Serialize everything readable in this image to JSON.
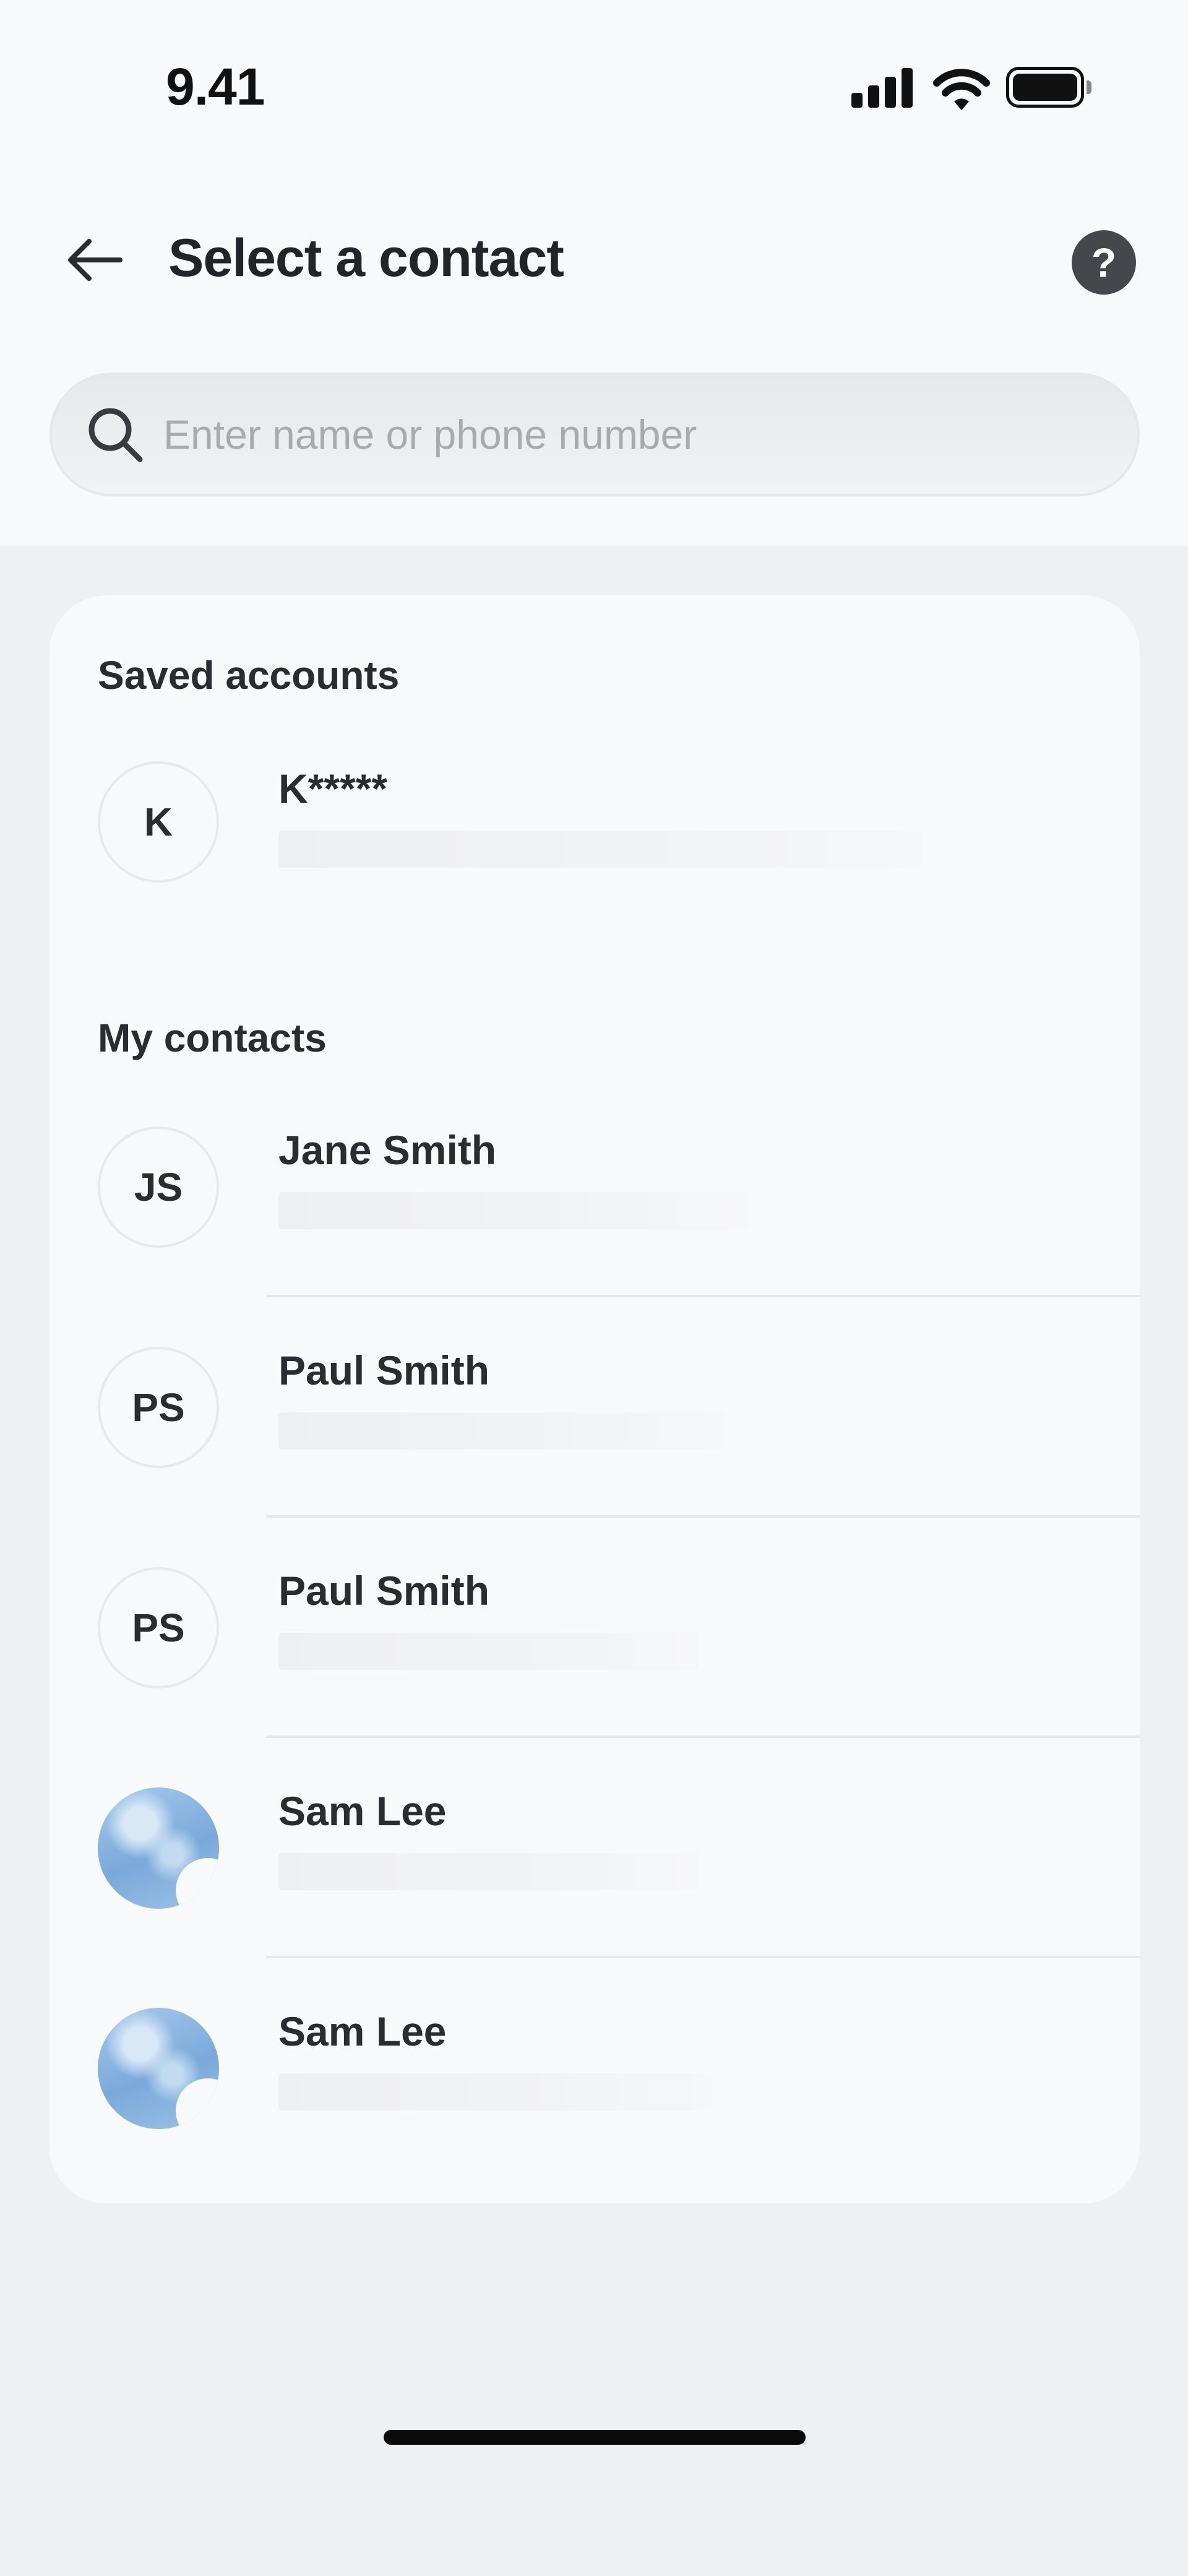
{
  "status_bar": {
    "time": "9.41",
    "signal_icon": "cellular-signal-icon",
    "wifi_icon": "wifi-icon",
    "battery_icon": "battery-full-icon"
  },
  "header": {
    "back_icon": "arrow-left-icon",
    "title": "Select a contact",
    "help_label": "?",
    "help_icon": "help-circle-icon"
  },
  "search": {
    "icon": "search-icon",
    "placeholder": "Enter name or phone number",
    "value": ""
  },
  "saved_accounts": {
    "title": "Saved accounts",
    "items": [
      {
        "initials": "K",
        "name": "K*****"
      }
    ]
  },
  "my_contacts": {
    "title": "My contacts",
    "items": [
      {
        "initials": "JS",
        "name": "Jane Smith",
        "avatar": "initials"
      },
      {
        "initials": "PS",
        "name": "Paul Smith",
        "avatar": "initials"
      },
      {
        "initials": "PS",
        "name": "Paul Smith",
        "avatar": "initials"
      },
      {
        "initials": "",
        "name": "Sam Lee",
        "avatar": "photo"
      },
      {
        "initials": "",
        "name": "Sam Lee",
        "avatar": "photo"
      }
    ]
  },
  "colors": {
    "background": "#eff0f2",
    "surface": "#f8f9fb",
    "text": "#23242a",
    "help_button": "#45474d"
  }
}
